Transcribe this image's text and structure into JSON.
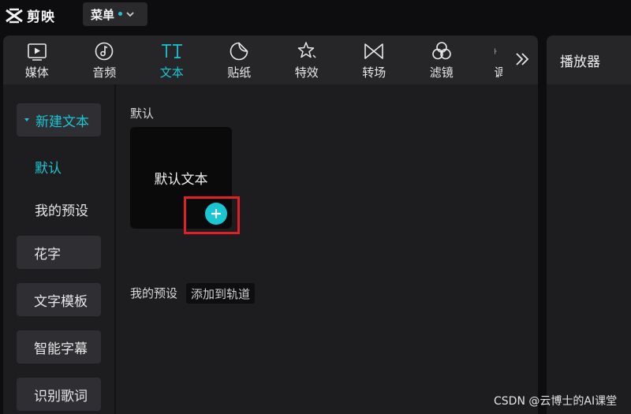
{
  "app": {
    "name": "剪映"
  },
  "menu": {
    "label": "菜单"
  },
  "tabs": [
    {
      "label": "媒体",
      "icon": "media-icon"
    },
    {
      "label": "音频",
      "icon": "audio-icon"
    },
    {
      "label": "文本",
      "icon": "text-icon",
      "active": true
    },
    {
      "label": "贴纸",
      "icon": "sticker-icon"
    },
    {
      "label": "特效",
      "icon": "effects-icon"
    },
    {
      "label": "转场",
      "icon": "transition-icon"
    },
    {
      "label": "滤镜",
      "icon": "filter-icon"
    },
    {
      "label": "调",
      "icon": "adjust-icon"
    }
  ],
  "sidenav": {
    "new_text": "新建文本",
    "default": "默认",
    "my_presets": "我的预设",
    "fancy_text": "花字",
    "text_template": "文字模板",
    "smart_captions": "智能字幕",
    "recognize_lyrics": "识别歌词"
  },
  "content": {
    "section_default": "默认",
    "card_label": "默认文本",
    "section_presets": "我的预设",
    "tooltip": "添加到轨道"
  },
  "player": {
    "title": "播放器"
  },
  "watermark": "CSDN @云博士的AI课堂",
  "colors": {
    "accent": "#19c6d3",
    "highlight": "#e02026"
  }
}
